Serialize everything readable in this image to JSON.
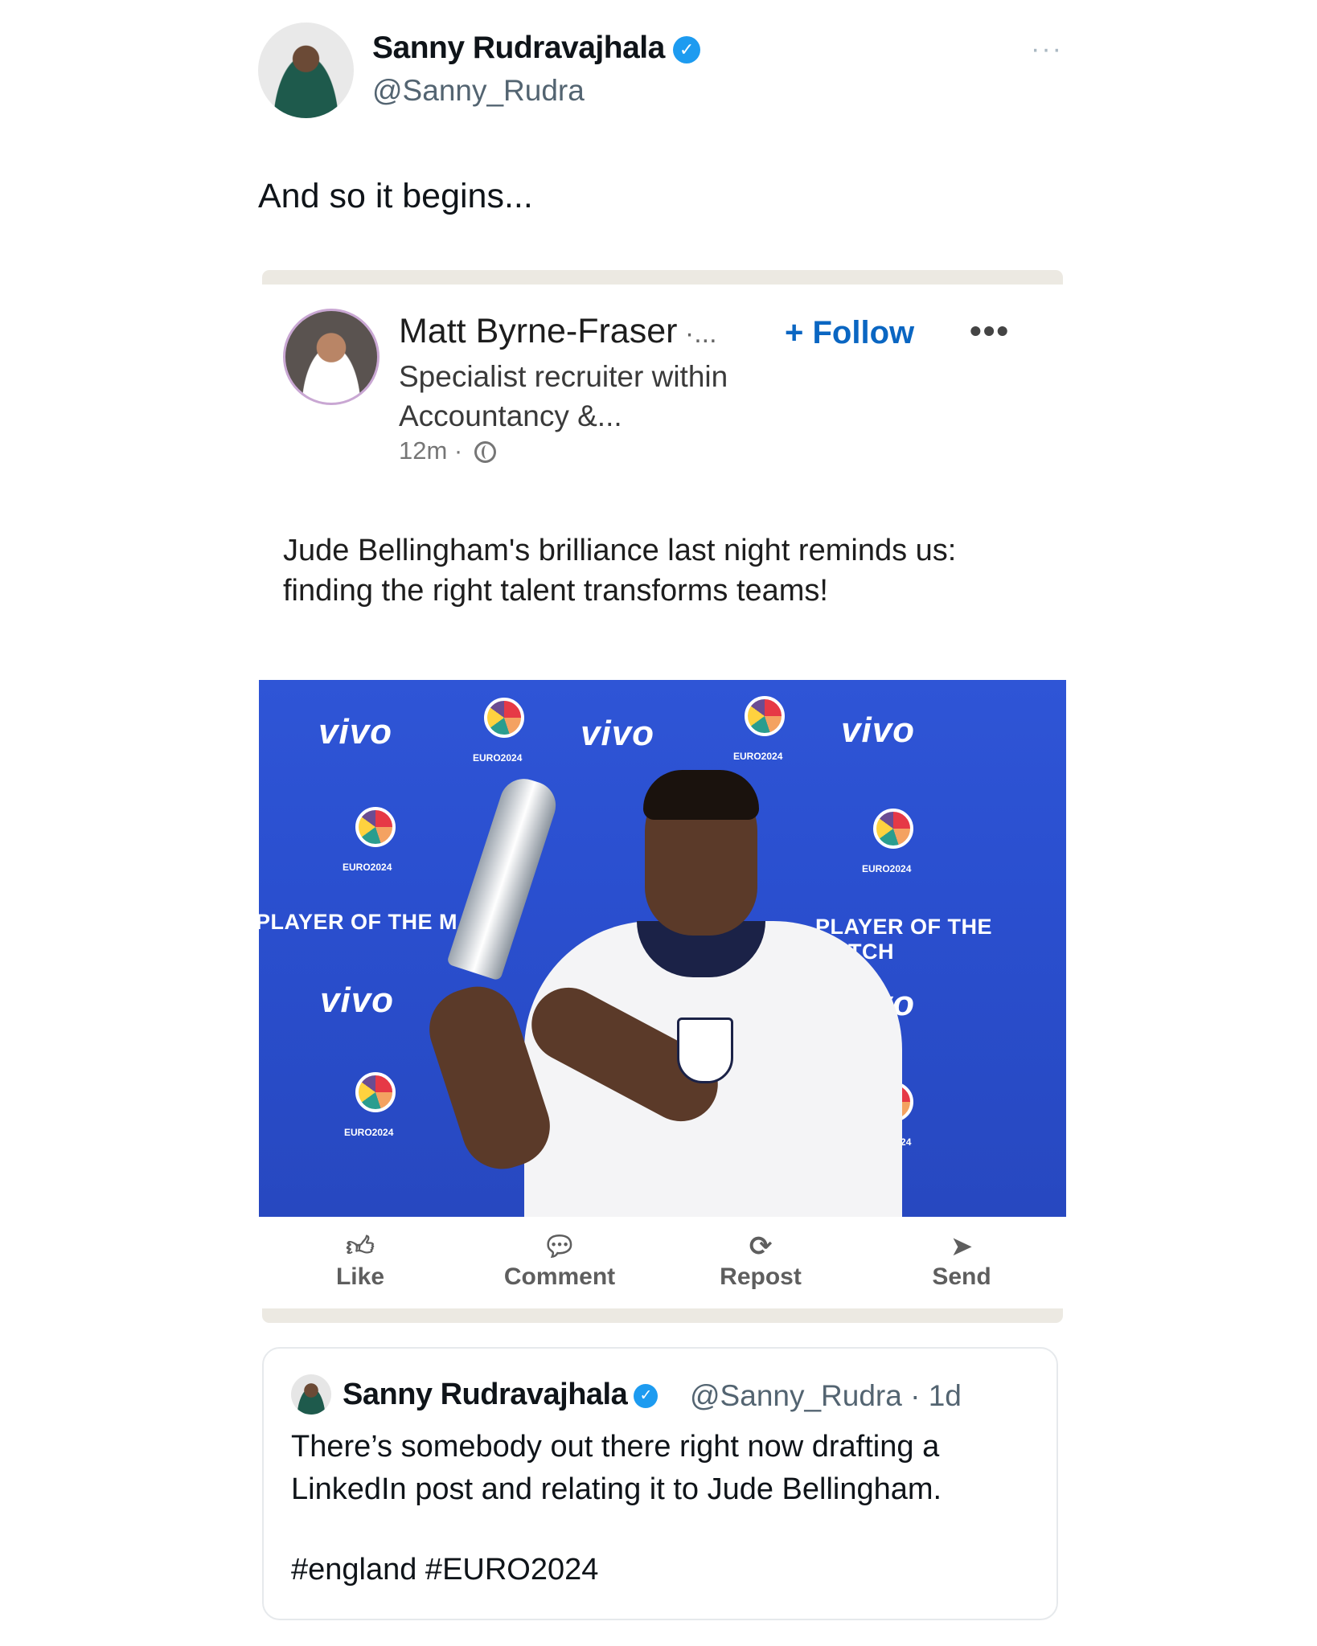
{
  "tweet": {
    "author_name": "Sanny Rudravajhala",
    "author_handle": "@Sanny_Rudra",
    "more_label": "···",
    "text": "And so it begins..."
  },
  "linkedin_post": {
    "author_name": "Matt Byrne-Fraser",
    "name_suffix": " ·...",
    "follow_label": "+ Follow",
    "more_label": "•••",
    "headline": "Specialist recruiter within Accountancy &...",
    "time": "12m ·",
    "text": "Jude Bellingham's brilliance last night reminds us: finding the right talent transforms teams!",
    "photo": {
      "sponsor_text": "vivo",
      "banner_text": "PLAYER OF THE MATCH",
      "event_logo_text": "EURO2024"
    },
    "actions": [
      {
        "label": "Like",
        "icon": "thumbs-up-icon"
      },
      {
        "label": "Comment",
        "icon": "comment-icon"
      },
      {
        "label": "Repost",
        "icon": "repost-icon"
      },
      {
        "label": "Send",
        "icon": "send-icon"
      }
    ]
  },
  "quoted_tweet": {
    "author_name": "Sanny Rudravajhala",
    "author_handle": "@Sanny_Rudra · 1d",
    "text": "There’s somebody out there right now drafting a LinkedIn post and relating it to Jude Bellingham.",
    "hashtags": "#england #EURO2024"
  },
  "colors": {
    "verified_blue": "#1d9bf0",
    "linkedin_blue": "#0a66c2",
    "photo_background": "#2a4fcf"
  }
}
